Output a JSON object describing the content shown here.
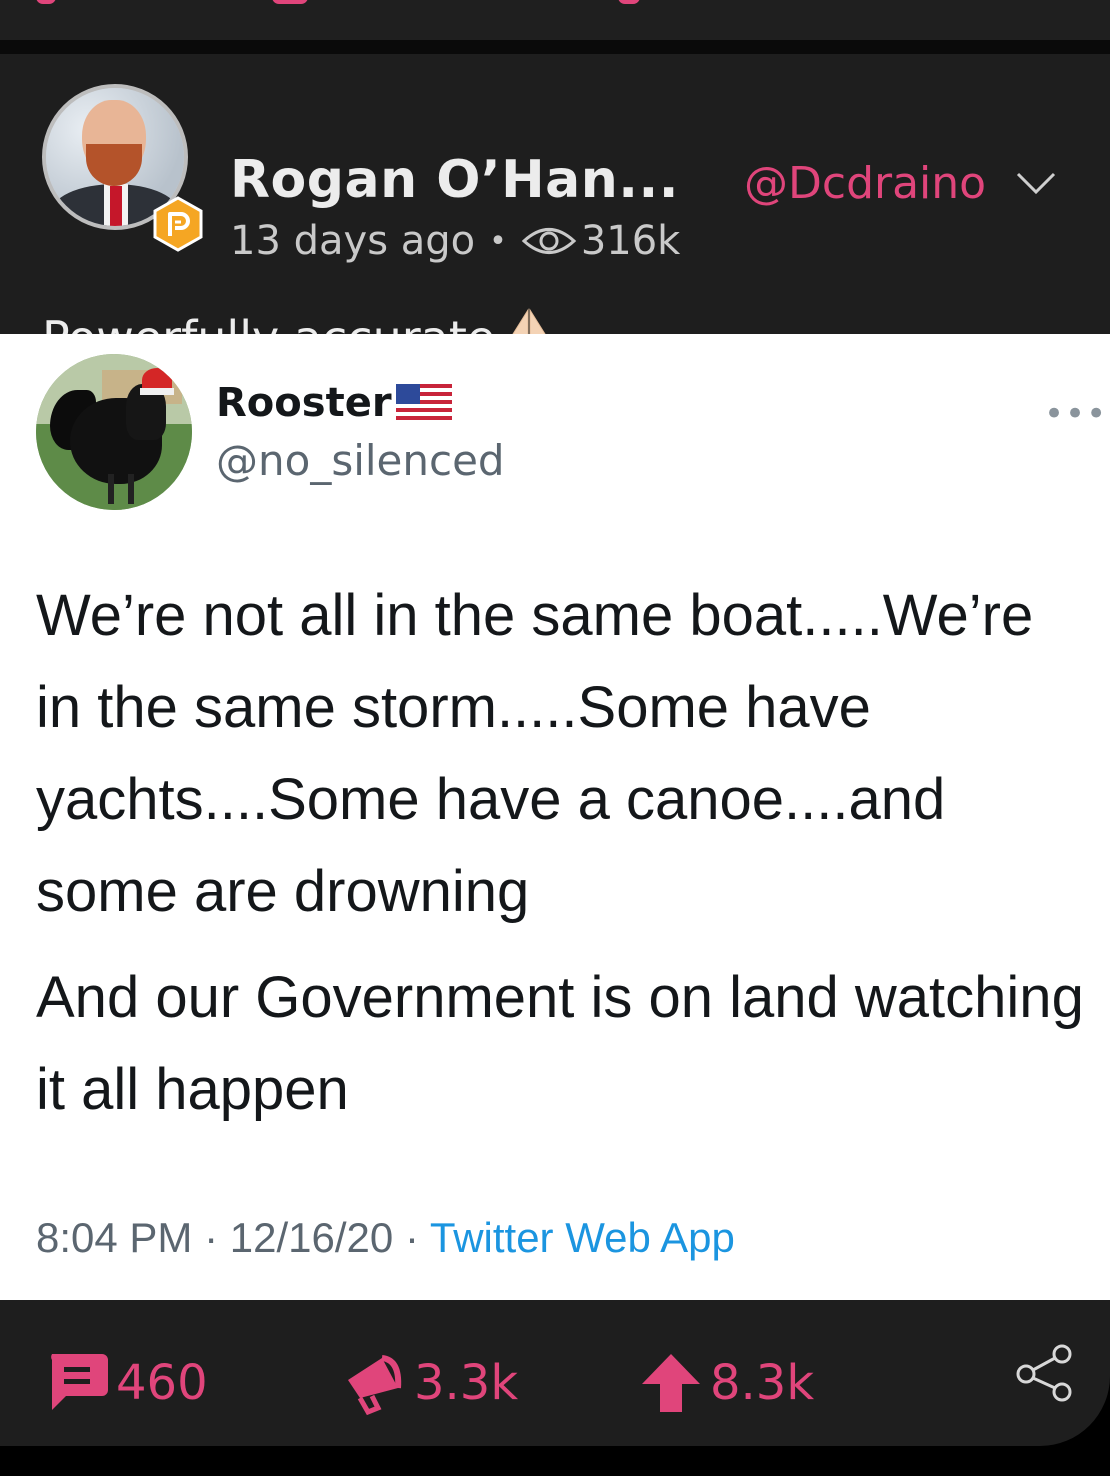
{
  "post": {
    "author_name": "Rogan O’Han...",
    "author_handle": "@Dcdraino",
    "time_ago": "13 days ago",
    "separator": "•",
    "views": "316k",
    "text": "Powerfully accurate",
    "emoji": "🙏",
    "avatar_icon": "user-avatar",
    "badge_icon": "parler-p-badge",
    "colors": {
      "accent": "#e0457b",
      "card_bg": "#1e1e1e",
      "text": "#ececec"
    }
  },
  "tweet": {
    "name": "Rooster",
    "flag_icon": "us-flag-icon",
    "handle": "@no_silenced",
    "more_label": "•••",
    "paragraphs": [
      "We’re not all in the same boat.....We’re in the same storm.....Some have yachts....Some have a canoe....and some are drowning",
      "And our Government is on land watching it all happen"
    ],
    "time": "8:04 PM",
    "dot": "·",
    "date": "12/16/20",
    "source": "Twitter Web App"
  },
  "actions": {
    "comments": "460",
    "echoes": "3.3k",
    "upvotes": "8.3k",
    "icons": [
      "comment-icon",
      "megaphone-icon",
      "upvote-icon",
      "share-icon"
    ]
  }
}
